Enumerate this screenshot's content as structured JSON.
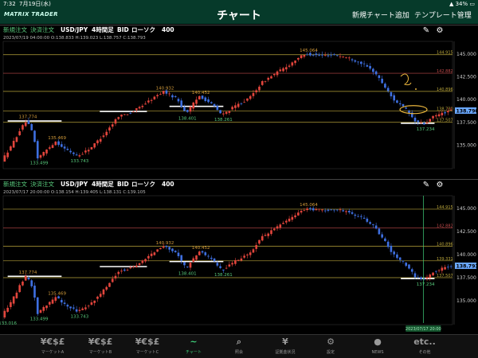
{
  "status": {
    "time": "7:32",
    "date": "7月19日(水)",
    "battery": "34%"
  },
  "header": {
    "logo": "MATRIX TRADER",
    "title": "チャート",
    "add_chart": "新規チャート追加",
    "template": "テンプレート管理"
  },
  "panels": [
    {
      "toolbar": {
        "new_order": "新規注文",
        "settle_order": "決済注文",
        "pair": "USD/JPY",
        "timeframe": "4時間足",
        "side": "BID",
        "chart_type": "ローソク",
        "count": "400"
      },
      "info": "2023/07/19 04:00:00   O:138.833   H:139.023   L:138.757   C:138.793",
      "axis_labels": [
        "145.000",
        "142.500",
        "140.000",
        "137.500",
        "135.000"
      ],
      "axis_values": [
        145,
        142.5,
        140,
        137.5,
        135
      ],
      "hlines": [
        {
          "label": "144.915",
          "value": 144.915,
          "color": "#b8a43a"
        },
        {
          "label": "142.882",
          "value": 142.882,
          "color": "#c04a4a"
        },
        {
          "label": "140.896",
          "value": 140.896,
          "color": "#b8a43a"
        },
        {
          "label": "138.730",
          "value": 138.73,
          "color": "#b8a43a"
        },
        {
          "label": "137.507",
          "value": 137.507,
          "color": "#b8a43a"
        }
      ],
      "current_price": "138.790",
      "current_value": 138.79,
      "annotations": [
        {
          "text": "145.064",
          "value": 145.064,
          "color": "#d19a3a",
          "pos": 0.68,
          "above": true
        },
        {
          "text": "140.932",
          "value": 140.932,
          "color": "#d19a3a",
          "pos": 0.36,
          "above": true
        },
        {
          "text": "140.452",
          "value": 140.452,
          "color": "#d19a3a",
          "pos": 0.44,
          "above": true
        },
        {
          "text": "138.401",
          "value": 138.401,
          "color": "#57c97b",
          "pos": 0.41,
          "above": false
        },
        {
          "text": "138.261",
          "value": 138.261,
          "color": "#57c97b",
          "pos": 0.49,
          "above": false
        },
        {
          "text": "137.774",
          "value": 137.774,
          "color": "#d19a3a",
          "pos": 0.055,
          "above": true
        },
        {
          "text": "135.469",
          "value": 135.469,
          "color": "#d19a3a",
          "pos": 0.12,
          "above": true
        },
        {
          "text": "133.499",
          "value": 133.499,
          "color": "#57c97b",
          "pos": 0.08,
          "above": false
        },
        {
          "text": "133.743",
          "value": 133.743,
          "color": "#57c97b",
          "pos": 0.17,
          "above": false
        },
        {
          "text": "137.234",
          "value": 137.234,
          "color": "#57c97b",
          "pos": 0.94,
          "above": false
        }
      ]
    },
    {
      "toolbar": {
        "new_order": "新規注文",
        "settle_order": "決済注文",
        "pair": "USD/JPY",
        "timeframe": "4時間足",
        "side": "BID",
        "chart_type": "ローソク",
        "count": "400"
      },
      "info": "2023/07/17 20:00:00   O:138.154   H:139.405   L:138.131   C:139.105",
      "axis_labels": [
        "145.000",
        "142.500",
        "140.000",
        "137.500",
        "135.000"
      ],
      "axis_values": [
        145,
        142.5,
        140,
        137.5,
        135
      ],
      "hlines": [
        {
          "label": "144.915",
          "value": 144.915,
          "color": "#b8a43a"
        },
        {
          "label": "142.882",
          "value": 142.882,
          "color": "#c04a4a"
        },
        {
          "label": "140.896",
          "value": 140.896,
          "color": "#b8a43a"
        },
        {
          "label": "139.331",
          "value": 139.331,
          "color": "#b8a43a"
        },
        {
          "label": "137.507",
          "value": 137.507,
          "color": "#b8a43a"
        }
      ],
      "current_price": "138.793",
      "current_value": 138.793,
      "crosshair_time": "2023/07/17 20:00",
      "annotations": [
        {
          "text": "145.064",
          "value": 145.064,
          "color": "#d19a3a",
          "pos": 0.68,
          "above": true
        },
        {
          "text": "140.932",
          "value": 140.932,
          "color": "#d19a3a",
          "pos": 0.36,
          "above": true
        },
        {
          "text": "140.452",
          "value": 140.452,
          "color": "#d19a3a",
          "pos": 0.44,
          "above": true
        },
        {
          "text": "138.401",
          "value": 138.401,
          "color": "#57c97b",
          "pos": 0.41,
          "above": false
        },
        {
          "text": "138.261",
          "value": 138.261,
          "color": "#57c97b",
          "pos": 0.49,
          "above": false
        },
        {
          "text": "137.774",
          "value": 137.774,
          "color": "#d19a3a",
          "pos": 0.055,
          "above": true
        },
        {
          "text": "135.469",
          "value": 135.469,
          "color": "#d19a3a",
          "pos": 0.12,
          "above": true
        },
        {
          "text": "133.016",
          "value": 133.016,
          "color": "#57c97b",
          "pos": 0.01,
          "above": false
        },
        {
          "text": "133.499",
          "value": 133.499,
          "color": "#57c97b",
          "pos": 0.08,
          "above": false
        },
        {
          "text": "133.743",
          "value": 133.743,
          "color": "#57c97b",
          "pos": 0.17,
          "above": false
        },
        {
          "text": "137.234",
          "value": 137.234,
          "color": "#57c97b",
          "pos": 0.94,
          "above": false
        }
      ]
    }
  ],
  "series_path": [
    [
      0,
      133.3
    ],
    [
      0.02,
      134.8
    ],
    [
      0.04,
      136.6
    ],
    [
      0.055,
      137.7
    ],
    [
      0.07,
      136.2
    ],
    [
      0.08,
      133.6
    ],
    [
      0.1,
      134.5
    ],
    [
      0.12,
      135.4
    ],
    [
      0.14,
      134.6
    ],
    [
      0.17,
      133.8
    ],
    [
      0.2,
      134.8
    ],
    [
      0.23,
      136.3
    ],
    [
      0.26,
      138.2
    ],
    [
      0.29,
      138.6
    ],
    [
      0.32,
      139.6
    ],
    [
      0.36,
      140.9
    ],
    [
      0.39,
      140.1
    ],
    [
      0.41,
      138.5
    ],
    [
      0.44,
      140.4
    ],
    [
      0.47,
      139.4
    ],
    [
      0.49,
      138.3
    ],
    [
      0.52,
      139.3
    ],
    [
      0.55,
      140.1
    ],
    [
      0.58,
      141.9
    ],
    [
      0.61,
      142.9
    ],
    [
      0.64,
      143.8
    ],
    [
      0.66,
      144.6
    ],
    [
      0.68,
      145.0
    ],
    [
      0.71,
      144.8
    ],
    [
      0.74,
      144.9
    ],
    [
      0.77,
      144.6
    ],
    [
      0.8,
      144.0
    ],
    [
      0.83,
      143.0
    ],
    [
      0.85,
      141.6
    ],
    [
      0.87,
      140.1
    ],
    [
      0.9,
      138.9
    ],
    [
      0.92,
      137.6
    ],
    [
      0.94,
      137.3
    ],
    [
      0.96,
      138.1
    ],
    [
      0.98,
      138.5
    ],
    [
      1,
      138.8
    ]
  ],
  "nav": [
    {
      "icon": "¥€$£",
      "label": "マーケットA"
    },
    {
      "icon": "¥€$£",
      "label": "マーケットB"
    },
    {
      "icon": "¥€$£",
      "label": "マーケットC"
    },
    {
      "icon": "~",
      "label": "チャート"
    },
    {
      "icon": "⌕",
      "label": "照会"
    },
    {
      "icon": "¥",
      "label": "証拠金状況"
    },
    {
      "icon": "⚙",
      "label": "設定"
    },
    {
      "icon": "●",
      "label": "NEWS"
    },
    {
      "icon": "etc..",
      "label": "その他"
    }
  ],
  "colors": {
    "header": "#063a2a",
    "up": "#e2453c",
    "down": "#3e6fe0",
    "accent": "#3fd07a",
    "price_box": "#6aa8ff"
  }
}
